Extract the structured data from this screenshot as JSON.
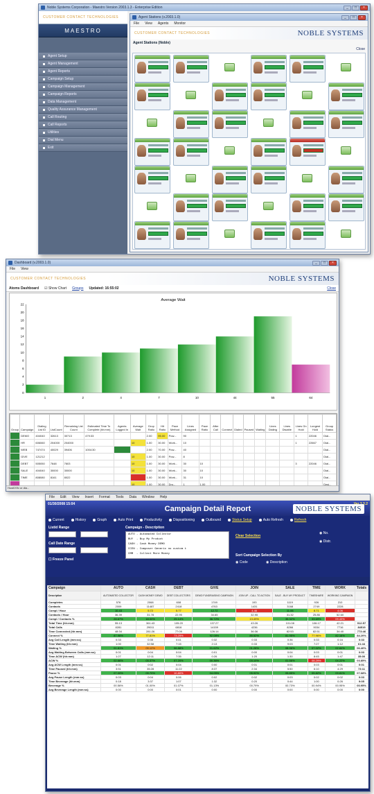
{
  "window1": {
    "title": "Noble Systems Corporation - Maestro Version 2003.1.3 - Enterprise Edition",
    "inner_title": "Agent Stations (v.2003.1.0)",
    "menu": [
      "File",
      "View",
      "Agents",
      "Monitor"
    ],
    "brand_tagline": "CUSTOMER CONTACT TECHNOLOGIES",
    "maestro": "MAESTRO",
    "logo": "NOBLE SYSTEMS",
    "section_title": "Agent Stations (Noble)",
    "close_label": "Close",
    "sidebar_items": [
      "Agent Setup",
      "Agent Management",
      "Agent Reports",
      "Campaign Setup",
      "Campaign Management",
      "Campaign Reports",
      "Data Management",
      "Quality Assurance Management",
      "Call Routing",
      "Call Reports",
      "Utilities",
      "Dial Menu",
      "Exit"
    ]
  },
  "window2": {
    "title": "Dashboard (v.2003.1.0)",
    "menu": [
      "File",
      "View"
    ],
    "logo": "NOBLE SYSTEMS",
    "toolbar": {
      "label": "Atoms Dashboard",
      "show_chart": "Show Chart",
      "groups": "Groups",
      "updated": "Updated: 16:55:02",
      "close": "Close"
    },
    "status_text": "HostDSN or dia...",
    "columns": [
      "Group",
      "Campaign",
      "Dialing List ID",
      "ListCount",
      "Remaining List Count",
      "Estimated Time To Complete (hh:mm)",
      "Agents Logged In",
      "Average Wait",
      "Drop Ratio",
      "Hit Ratio",
      "Pace Method",
      "Lines Assigned",
      "Pace Ratio",
      "After Call",
      "Connect",
      "Dialed",
      "Paused",
      "Waiting",
      "Lines Dialing",
      "Lines Disable",
      "Lines On Hold",
      "Longest Hold",
      "Group Status"
    ],
    "rows": [
      {
        "group": "",
        "camp": "DEMO",
        "list": "404040",
        "lc": "32613",
        "rem": "30713",
        "etc": "479:33",
        "agents": "",
        "wait": "",
        "drop": "2.00",
        "hit": "95.00",
        "pace": "Pow...",
        "la": "90",
        "pr": "",
        "ac": "",
        "cn": "",
        "di": "",
        "pa": "",
        "wa": "",
        "ld": "",
        "lds": "",
        "lh": "1",
        "lgh": "22046",
        "gs": "Dial..."
      },
      {
        "group": "",
        "camp": "HR",
        "list": "606060",
        "lc": "204000",
        "rem": "204000",
        "etc": "",
        "agents": "",
        "wait": "10",
        "drop": "1.00",
        "hit": "30.00",
        "pace": "Work...",
        "la": "10",
        "pr": "",
        "ac": "",
        "cn": "",
        "di": "",
        "pa": "",
        "wa": "",
        "ld": "",
        "lds": "",
        "lh": "1",
        "lgh": "22667",
        "gs": "Dial..."
      },
      {
        "group": "",
        "camp": "WEB",
        "list": "747474",
        "lc": "40029",
        "rem": "39406",
        "etc": "1004:30",
        "agents": "",
        "wait": "",
        "drop": "2.00",
        "hit": "70.00",
        "pace": "Pow...",
        "la": "40",
        "pr": "",
        "ac": "",
        "cn": "",
        "di": "",
        "pa": "",
        "wa": "",
        "ld": "",
        "lds": "",
        "lh": "",
        "lgh": "",
        "gs": "Dial..."
      },
      {
        "group": "",
        "camp": "GIVE",
        "list": "121212",
        "lc": "",
        "rem": "",
        "etc": "",
        "agents": "",
        "wait": "10",
        "drop": "1.00",
        "hit": "30.00",
        "pace": "Pow...",
        "la": "8",
        "pr": "",
        "ac": "",
        "cn": "",
        "di": "",
        "pa": "",
        "wa": "",
        "ld": "",
        "lds": "",
        "lh": "",
        "lgh": "",
        "gs": "Dial..."
      },
      {
        "group": "",
        "camp": "DEBT",
        "list": "505050",
        "lc": "7648",
        "rem": "7603",
        "etc": "",
        "agents": "",
        "wait": "10",
        "drop": "1.00",
        "hit": "30.00",
        "pace": "Work...",
        "la": "30",
        "pr": "10",
        "ac": "",
        "cn": "",
        "di": "",
        "pa": "",
        "wa": "",
        "ld": "",
        "lds": "",
        "lh": "3",
        "lgh": "22046",
        "gs": "Dial..."
      },
      {
        "group": "",
        "camp": "SALE",
        "list": "404040",
        "lc": "30000",
        "rem": "30000",
        "etc": "",
        "agents": "",
        "wait": "10",
        "drop": "1.00",
        "hit": "30.00",
        "pace": "Work...",
        "la": "30",
        "pr": "10",
        "ac": "",
        "cn": "",
        "di": "",
        "pa": "",
        "wa": "",
        "ld": "",
        "lds": "",
        "lh": "",
        "lgh": "",
        "gs": "Dial..."
      },
      {
        "group": "",
        "camp": "TIME",
        "list": "808080",
        "lc": "8161",
        "rem": "8022",
        "etc": "",
        "agents": "",
        "wait": "",
        "drop": "1.00",
        "hit": "30.00",
        "pace": "Work...",
        "la": "31",
        "pr": "10",
        "ac": "",
        "cn": "",
        "di": "",
        "pa": "",
        "wa": "",
        "ld": "",
        "lds": "",
        "lh": "",
        "lgh": "",
        "gs": "Dial..."
      },
      {
        "group": "",
        "camp": "",
        "list": "",
        "lc": "",
        "rem": "",
        "etc": "",
        "agents": "",
        "wait": "10",
        "drop": "1.00",
        "hit": "30.00",
        "pace": "Dro...",
        "la": "1",
        "pr": "1.00",
        "ac": "",
        "cn": "",
        "di": "",
        "pa": "",
        "wa": "",
        "ld": "",
        "lds": "",
        "lh": "",
        "lgh": "",
        "gs": "Desi..."
      }
    ]
  },
  "chart_data": {
    "type": "bar",
    "title": "Average Wait",
    "categories": [
      "1",
      "2",
      "4",
      "7",
      "10",
      "44",
      "55",
      "64"
    ],
    "values": [
      2,
      9,
      10,
      11,
      12,
      14,
      19,
      7
    ],
    "colors": [
      "green",
      "green",
      "green",
      "green",
      "green",
      "green",
      "green",
      "magenta"
    ],
    "ylim": [
      0,
      22
    ],
    "yticks": [
      0,
      2,
      4,
      6,
      8,
      10,
      12,
      14,
      16,
      18,
      20,
      22
    ],
    "grid": false
  },
  "window3": {
    "menu": [
      "File",
      "Edit",
      "View",
      "Insert",
      "Format",
      "Tools",
      "Data",
      "Window",
      "Help"
    ],
    "date": "01/30/2008 15:04",
    "version": "Ver 3.3.2",
    "title": "Campaign Detail Report",
    "logo": "NOBLE SYSTEMS",
    "options": [
      "Current",
      "History",
      "Graph",
      "Auto Print",
      "Productivity",
      "Dispositioning",
      "Outbound",
      "Status Setup",
      "Auto Refresh",
      "Refresh"
    ],
    "list_range": "Listid Range",
    "call_date_range": "Call Date Range",
    "freeze_panel": "Freeze Panel",
    "campaign_desc": "Campaign - Description",
    "campaign_list": [
      "AUTO - Automated Collector",
      "BUY  - Buy My Product",
      "CASH - Cash Money DEMO",
      "CCEN - Composer Generic no custom t",
      "CMM  - Collect More Money"
    ],
    "clear_selection": "Clear Selection",
    "sort_label": "Sort Campaign Selection By",
    "sort_code": "Code",
    "sort_desc": "Description",
    "opt_no": "No.",
    "opt_distr": "Distr.",
    "col_campaign": "Campaign",
    "col_description": "Description",
    "campaigns": [
      "AUTO",
      "CASH",
      "DEBT",
      "GIVE",
      "JOIN",
      "SALE",
      "TIME",
      "WORK",
      "Totals"
    ],
    "descriptions": [
      "AUTOMATED COLLECTOR",
      "CASH MONEY DEMO",
      "DEBT COLLECTORS",
      "DEMO FUNDRAISING CAMPAIGN",
      "JOIN UP - CALL TO ACTION",
      "SALE - BUY MY PRODUCT",
      "TIMESHARE",
      "WORKING CAMPAIGN",
      ""
    ],
    "rows": [
      {
        "label": "Completes",
        "v": [
          "576",
          "2068",
          "608",
          "1749",
          "193",
          "1119",
          "926",
          "210",
          ""
        ],
        "c": []
      },
      {
        "label": "Contacts",
        "v": [
          "2009",
          "11487",
          "2418",
          "4763",
          "1431",
          "3168",
          "2749",
          "2228",
          ""
        ],
        "c": []
      },
      {
        "label": "Compl / Hour",
        "v": [
          "10.43",
          "5.72",
          "5.77",
          "12.72",
          "4.46",
          "11.06",
          "8.71",
          "4.06",
          ""
        ],
        "c": [
          "g",
          "yl",
          "yl",
          "g",
          "r",
          "g",
          "yl",
          "r",
          ""
        ]
      },
      {
        "label": "Contacts / Hour",
        "v": [
          "36.39",
          "31.78",
          "22.95",
          "34.65",
          "32.95",
          "31.32",
          "25.86",
          "52.60",
          ""
        ],
        "c": []
      },
      {
        "label": "Compl / Contacts %",
        "v": [
          "28.67%",
          "18.00%",
          "25.14%",
          "36.72%",
          "13.49%",
          "35.32%",
          "33.69%",
          "09.43%",
          ""
        ],
        "c": [
          "g",
          "g",
          "g",
          "g",
          "yl",
          "g",
          "g",
          "r",
          ""
        ]
      },
      {
        "label": "Total Time (hh:mm)",
        "v": [
          "55:13",
          "361:43",
          "105:20",
          "137:27",
          "43:26",
          "101:08",
          "106:17",
          "42:21",
          "912:57"
        ],
        "c": []
      },
      {
        "label": "Total Calls",
        "v": [
          "8281",
          "29011",
          "6816",
          "14159",
          "4236",
          "8266",
          "9034",
          "7716",
          "84519"
        ],
        "c": []
      },
      {
        "label": "Time Connected (hh:mm)",
        "v": [
          "48:34",
          "281:26",
          "77:09",
          "126:14",
          "36:36",
          "82:53",
          "82:51",
          "34:40",
          "773:46"
        ],
        "c": []
      },
      {
        "label": "Connect %",
        "v": [
          "87.96%",
          "77.81%",
          "73.25%",
          "92.08%",
          "85.52%",
          "81.95%",
          "77.96%",
          "82.16%",
          "84.20%"
        ],
        "c": [
          "g",
          "yl",
          "r",
          "g",
          "g",
          "g",
          "yl",
          "g",
          ""
        ]
      },
      {
        "label": "Avg Call Length (mm:ss)",
        "v": [
          "0:33",
          "0:35",
          "0:41",
          "0:32",
          "0:33",
          "0:36",
          "0:33",
          "0:16",
          "0:33"
        ],
        "c": []
      },
      {
        "label": "Time Waiting (hh:mm)",
        "v": [
          "1:00",
          "32:58",
          "7:15",
          "2:13",
          "0:33",
          "9:03",
          "7:27",
          "1:12",
          "61:44"
        ],
        "c": []
      },
      {
        "label": "Waiting %",
        "v": [
          "01.81%",
          "09.12%",
          "06.88%",
          "01.62%",
          "01.28%",
          "08.96%",
          "07.02%",
          "02.84%",
          "06.40%"
        ],
        "c": [
          "g",
          "o",
          "g",
          "g",
          "g",
          "g",
          "g",
          "g",
          ""
        ]
      },
      {
        "label": "Avg Waiting Between Calls (mm:ss)",
        "v": [
          "0:01",
          "0:04",
          "0:04",
          "0:01",
          "0:00",
          "0:04",
          "0:03",
          "0:01",
          "0:03"
        ],
        "c": []
      },
      {
        "label": "Time ACW (hh:mm)",
        "v": [
          "1:27",
          "12:11",
          "7:35",
          "0:26",
          "1:20",
          "1:30",
          "8:45",
          "1:47",
          "35:00"
        ],
        "c": []
      },
      {
        "label": "ACW %",
        "v": [
          "02.66%",
          "03.37%",
          "07.20%",
          "00.36%",
          "03.10%",
          "01.56%",
          "08.29%",
          "04.22%",
          "03.85%"
        ],
        "c": [
          "g",
          "g",
          "g",
          "g",
          "g",
          "g",
          "r",
          "g",
          ""
        ]
      },
      {
        "label": "Avg ACW Length (mm:ss)",
        "v": [
          "0:01",
          "0:02",
          "0:04",
          "0:00",
          "0:01",
          "0:01",
          "0:03",
          "0:01",
          "0:01"
        ],
        "c": []
      },
      {
        "label": "Time Paused (hh:mm)",
        "v": [
          "3:51",
          "35:28",
          "11:22",
          "8:37",
          "2:34",
          "5:50",
          "6:10",
          "4:29",
          "73:11"
        ],
        "c": []
      },
      {
        "label": "Pause %",
        "v": [
          "07.00%",
          "09.70%",
          "10.80%",
          "04.05%",
          "05.92%",
          "05.85%",
          "05.82%",
          "09.81%",
          "07.68%"
        ],
        "c": [
          "g",
          "g",
          "r",
          "g",
          "g",
          "g",
          "g",
          "g",
          ""
        ]
      },
      {
        "label": "Avg Pause Length (mm:ss)",
        "v": [
          "0:03",
          "0:04",
          "0:06",
          "0:02",
          "0:02",
          "0:03",
          "0:02",
          "0:02",
          "0:03"
        ],
        "c": []
      },
      {
        "label": "Time Beverage (hh:mm)",
        "v": [
          "0:18",
          "3:37",
          "1:07",
          "1:32",
          "0:20",
          "0:44",
          "1:00",
          "0:26",
          "9:05"
        ],
        "c": []
      },
      {
        "label": "Beverage %",
        "v": [
          "00.56%",
          "01.00%",
          "01.07%",
          "01.13%",
          "00.79%",
          "00.73%",
          "00.94%",
          "00.95%",
          "00.95%"
        ],
        "c": []
      },
      {
        "label": "Avg Beverage Length (mm:ss)",
        "v": [
          "0:00",
          "0:00",
          "0:01",
          "0:00",
          "0:00",
          "0:00",
          "0:00",
          "0:00",
          "0:00"
        ],
        "c": []
      }
    ]
  }
}
